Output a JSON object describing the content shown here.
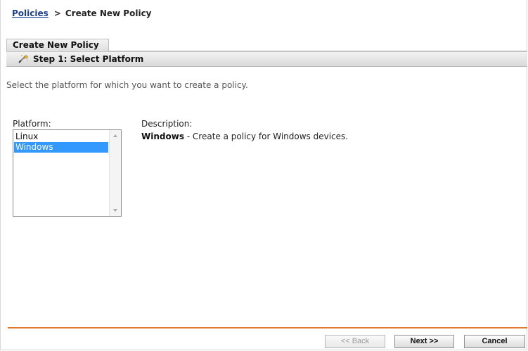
{
  "breadcrumb": {
    "parent": "Policies",
    "separator": ">",
    "current": "Create New Policy"
  },
  "panel": {
    "tab_title": "Create New Policy",
    "step_title": "Step 1: Select Platform",
    "step_icon": "wand-icon"
  },
  "main": {
    "intro": "Select the platform for which you want to create a policy.",
    "platform_label": "Platform:",
    "platforms": [
      {
        "label": "Linux",
        "selected": false
      },
      {
        "label": "Windows",
        "selected": true
      }
    ],
    "description_label": "Description:",
    "description_name": "Windows",
    "description_text": " - Create a policy for Windows devices."
  },
  "footer": {
    "back_label": "<< Back",
    "next_label": "Next >>",
    "cancel_label": "Cancel"
  },
  "colors": {
    "link": "#1b3f93",
    "selection": "#3399ff",
    "accent_rule": "#e1782d"
  }
}
